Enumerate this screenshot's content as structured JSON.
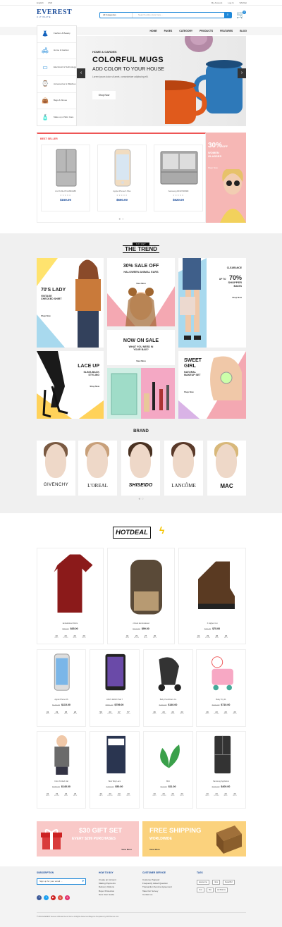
{
  "topbar": {
    "language": "English",
    "currency": "USD",
    "links": [
      "My Account",
      "Log In",
      "Wishlist"
    ]
  },
  "logo": {
    "name": "EVEREST",
    "tagline": "ULTIMATE"
  },
  "search": {
    "category": "All Categories",
    "placeholder": "Search entire store here..."
  },
  "cart": {
    "count": "0"
  },
  "nav": [
    "HOME",
    "PAGES",
    "CATEGORY",
    "PRODUCTS",
    "FEATURES",
    "BLOG"
  ],
  "sidebar": {
    "items": [
      {
        "label": "Fashion & Beauty",
        "icon": "dress-icon"
      },
      {
        "label": "Home & Garden",
        "icon": "sofa-icon"
      },
      {
        "label": "Electronic & Technology",
        "icon": "tv-icon"
      },
      {
        "label": "Accessories & Watches",
        "icon": "watch-icon"
      },
      {
        "label": "Bags & Shoes",
        "icon": "bag-icon"
      },
      {
        "label": "Make up & Skin Care",
        "icon": "lotion-icon"
      }
    ]
  },
  "hero": {
    "subtitle": "HOME & GARDEN",
    "title": "COLORFUL MUGS",
    "title2": "ADD COLOR TO YOUR HOUSE",
    "desc": "Lorem ipsum dolor sit amet, consectetuer adipiscing elit.",
    "cta": "Shop Now"
  },
  "best_seller": {
    "title": "BEST SELLER",
    "products": [
      {
        "name": "LG Profile PFL1893H85",
        "price": "$150.00"
      },
      {
        "name": "Apple iPhone 6 Plus",
        "price": "$660.00"
      },
      {
        "name": "Samsung RF1PN083M",
        "price": "$520.00"
      }
    ]
  },
  "promo": {
    "big": "30%",
    "off": "OFF",
    "line1": "WOMEN",
    "line2": "GLASSES",
    "link": "Shop Now"
  },
  "trend": {
    "label_top": "GO GET",
    "label_main": "THE TREND",
    "t1": {
      "title": "70'S LADY",
      "desc": "VINTAGE CHECKED SHIRT",
      "link": "Shop Now"
    },
    "t2": {
      "title": "30% SALE OFF",
      "desc": "HALOWEEN ANIMAL EARS",
      "link": "View More"
    },
    "t3": {
      "small": "CLEARANCE",
      "upto": "UP TO",
      "big": "70%",
      "desc": "SHOPPER BAGS",
      "link": "Shop Now"
    },
    "t4": {
      "title": "NOW ON SALE",
      "desc": "WHAT YOU NEED IN YOUR BAG?",
      "link": "View More"
    },
    "t5": {
      "title": "LACE UP",
      "desc": "SLING-BACK STYLING",
      "link": "Shop Now"
    },
    "t6": {
      "title": "SWEET GIRL",
      "desc": "NATURAL MAKEUP SET",
      "link": "Shop Now"
    }
  },
  "brand": {
    "title": "BRAND",
    "names": [
      "GIVENCHY",
      "L'OREAL",
      "SHISEIDO",
      "LANCÔME",
      "MAC"
    ]
  },
  "hotdeal": {
    "title": "HOTDEAL",
    "units": [
      "DAYS",
      "HOURS",
      "MINS",
      "SECS"
    ],
    "products": [
      {
        "name": "Embellished Shirts",
        "old": "$80.00",
        "new": "$65.00",
        "count": [
          "43",
          "23",
          "23",
          "20"
        ]
      },
      {
        "name": "J.Fluck Embroidered",
        "old": "$110.00",
        "new": "$99.00",
        "count": [
          "43",
          "23",
          "27",
          "20"
        ]
      },
      {
        "name": "X Higher Cut",
        "old": "$90.00",
        "new": "$75.00",
        "count": [
          "43",
          "23",
          "26",
          "20"
        ]
      },
      {
        "name": "Apple iPhone 6S",
        "old": "$140.00",
        "new": "$115.00",
        "count": [
          "43",
          "23",
          "25",
          "20"
        ]
      },
      {
        "name": "ASUS MeMO Pad 7",
        "old": "$860.00",
        "new": "$759.00",
        "count": [
          "59",
          "23",
          "37",
          "57"
        ]
      },
      {
        "name": "Baby Pushchairs Co",
        "old": "$190.00",
        "new": "$140.00",
        "count": [
          "49",
          "23",
          "23",
          "23"
        ]
      },
      {
        "name": "Baby Toy 01",
        "old": "$720.00",
        "new": "$710.00",
        "count": [
          "49",
          "23",
          "23",
          "23"
        ]
      },
      {
        "name": "Color Knitted Hat",
        "old": "$180.00",
        "new": "$145.00",
        "count": [
          "43",
          "23",
          "23",
          "23"
        ]
      },
      {
        "name": "Best Way Lace",
        "old": "$150.00",
        "new": "$50.00",
        "count": [
          "43",
          "23",
          "23",
          "23"
        ]
      },
      {
        "name": "Mint",
        "old": "$14.00",
        "new": "$11.00",
        "count": [
          "43",
          "23",
          "23",
          "23"
        ]
      },
      {
        "name": "Samsung Appliance",
        "old": "$720.00",
        "new": "$400.00",
        "count": [
          "43",
          "23",
          "23",
          "23"
        ]
      }
    ]
  },
  "gift": {
    "title": "$30 GIFT SET",
    "sub": "EVERY $299 PURCHASES",
    "link": "View More"
  },
  "ship": {
    "title": "FREE SHIPPING",
    "sub": "WORLDWIDE",
    "link": "View More"
  },
  "footer": {
    "subscription": {
      "title": "SUBSCRIPTION",
      "placeholder": "Sign up for your email ..."
    },
    "how_to_buy": {
      "title": "HOW TO BUY",
      "links": [
        "Create an Account",
        "Making Payments",
        "Delivery Options",
        "Buyer Protection",
        "New User Guide"
      ]
    },
    "customer_service": {
      "title": "CUSTOMER SERVICE",
      "links": [
        "Customer Support",
        "Frequently Asked Question",
        "Transaction Service Agreement",
        "Take Our Survey",
        "Contact us"
      ]
    },
    "tags": {
      "title": "TAGS",
      "items": [
        "awesome",
        "nice",
        "beautiful",
        "love",
        "like",
        "ambitions"
      ]
    },
    "copyright": "© 2018 EVEREST Everest Ultimate Demo Store. All Rights Reserved.Magento Templates by ZDTthemes.com"
  },
  "colors": {
    "brand": "#1a4c9a",
    "accent": "#1e88d9",
    "sale": "#e44444"
  }
}
